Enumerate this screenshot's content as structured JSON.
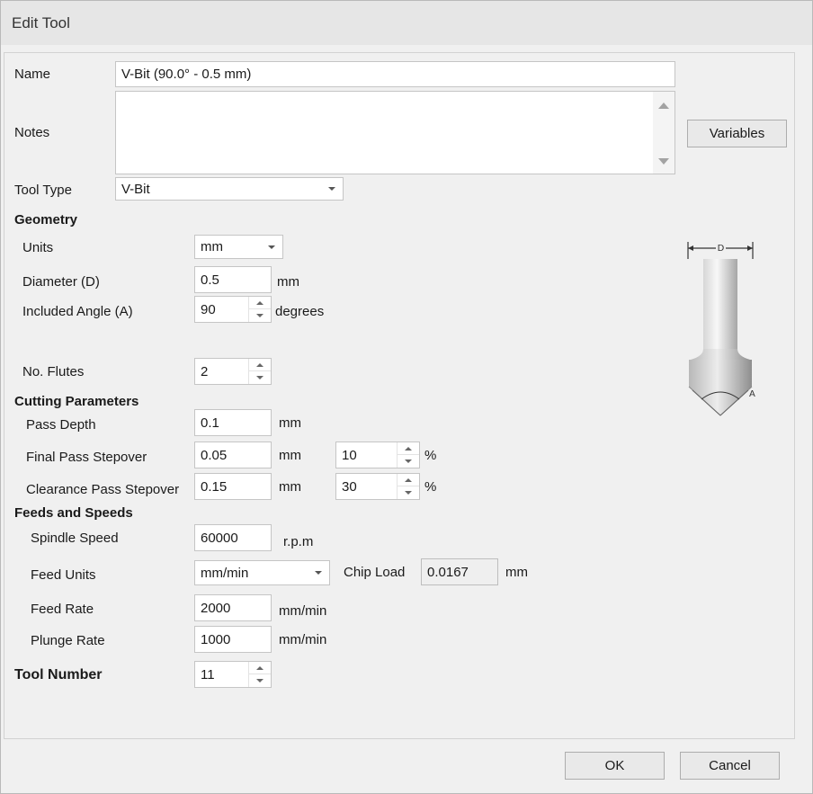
{
  "window": {
    "title": "Edit Tool"
  },
  "form": {
    "name_label": "Name",
    "name_value": "V-Bit (90.0° - 0.5 mm)",
    "notes_label": "Notes",
    "notes_value": "",
    "variables_button": "Variables",
    "tool_type_label": "Tool Type",
    "tool_type_value": "V-Bit"
  },
  "geometry": {
    "heading": "Geometry",
    "units_label": "Units",
    "units_value": "mm",
    "diameter_label": "Diameter (D)",
    "diameter_value": "0.5",
    "diameter_unit": "mm",
    "angle_label": "Included Angle (A)",
    "angle_value": "90",
    "angle_unit": "degrees",
    "flutes_label": "No. Flutes",
    "flutes_value": "2"
  },
  "illustration": {
    "icon": "v-bit-tool-diagram",
    "diameter_marker": "D",
    "angle_marker": "A"
  },
  "cutting": {
    "heading": "Cutting Parameters",
    "pass_depth_label": "Pass Depth",
    "pass_depth_value": "0.1",
    "pass_depth_unit": "mm",
    "final_stepover_label": "Final Pass Stepover",
    "final_stepover_value": "0.05",
    "final_stepover_unit": "mm",
    "final_stepover_percent": "10",
    "clearance_stepover_label": "Clearance Pass Stepover",
    "clearance_stepover_value": "0.15",
    "clearance_stepover_unit": "mm",
    "clearance_stepover_percent": "30",
    "percent_symbol": "%"
  },
  "feeds": {
    "heading": "Feeds and Speeds",
    "spindle_label": "Spindle Speed",
    "spindle_value": "60000",
    "spindle_unit": "r.p.m",
    "feed_units_label": "Feed Units",
    "feed_units_value": "mm/min",
    "chip_load_label": "Chip Load",
    "chip_load_value": "0.0167",
    "chip_load_unit": "mm",
    "feed_rate_label": "Feed Rate",
    "feed_rate_value": "2000",
    "feed_rate_unit": "mm/min",
    "plunge_rate_label": "Plunge Rate",
    "plunge_rate_value": "1000",
    "plunge_rate_unit": "mm/min"
  },
  "tool_number": {
    "label": "Tool Number",
    "value": "11"
  },
  "footer": {
    "ok": "OK",
    "cancel": "Cancel"
  }
}
